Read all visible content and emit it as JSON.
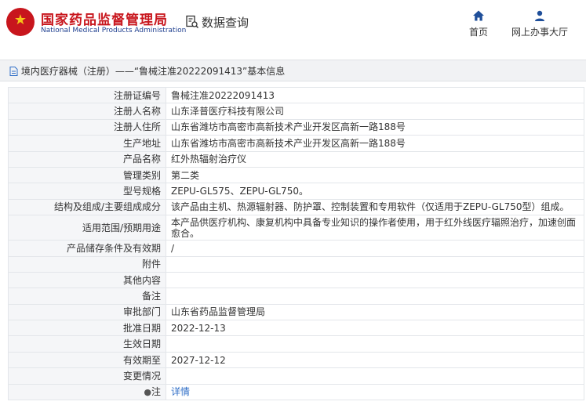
{
  "header": {
    "site_name_cn": "国家药品监督管理局",
    "site_name_en": "National Medical Products Administration",
    "data_query": "数据查询",
    "nav": [
      {
        "label": "首页",
        "icon": "home-icon"
      },
      {
        "label": "网上办事大厅",
        "icon": "user-icon"
      }
    ]
  },
  "breadcrumb": {
    "text": "境内医疗器械（注册）——“鲁械注准20222091413”基本信息"
  },
  "rows": [
    {
      "label": "注册证编号",
      "value": "鲁械注准20222091413"
    },
    {
      "label": "注册人名称",
      "value": "山东泽普医疗科技有限公司"
    },
    {
      "label": "注册人住所",
      "value": "山东省潍坊市高密市高新技术产业开发区高新一路188号"
    },
    {
      "label": "生产地址",
      "value": "山东省潍坊市高密市高新技术产业开发区高新一路188号"
    },
    {
      "label": "产品名称",
      "value": "红外热辐射治疗仪"
    },
    {
      "label": "管理类别",
      "value": "第二类"
    },
    {
      "label": "型号规格",
      "value": "ZEPU-GL575、ZEPU-GL750。"
    },
    {
      "label": "结构及组成/主要组成成分",
      "value": "该产品由主机、热源辐射器、防护罩、控制装置和专用软件（仅适用于ZEPU-GL750型）组成。"
    },
    {
      "label": "适用范围/预期用途",
      "value": "本产品供医疗机构、康复机构中具备专业知识的操作者使用，用于红外线医疗辐照治疗，加速创面愈合。"
    },
    {
      "label": "产品储存条件及有效期",
      "value": "/"
    },
    {
      "label": "附件",
      "value": ""
    },
    {
      "label": "其他内容",
      "value": ""
    },
    {
      "label": "备注",
      "value": ""
    },
    {
      "label": "审批部门",
      "value": "山东省药品监督管理局"
    },
    {
      "label": "批准日期",
      "value": "2022-12-13"
    },
    {
      "label": "生效日期",
      "value": ""
    },
    {
      "label": "有效期至",
      "value": "2027-12-12"
    },
    {
      "label": "变更情况",
      "value": ""
    },
    {
      "label": "注",
      "value": "详情"
    }
  ]
}
